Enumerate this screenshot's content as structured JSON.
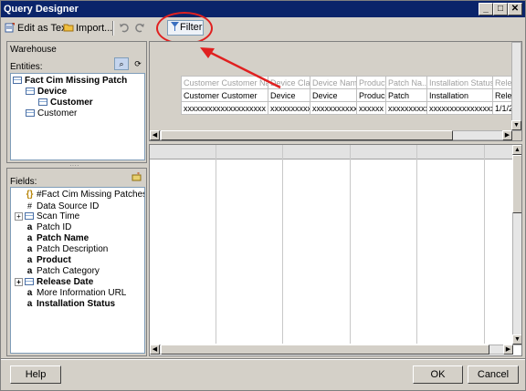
{
  "window": {
    "title": "Query Designer"
  },
  "title_buttons": {
    "minimize": "_",
    "maximize": "□",
    "close": "✕"
  },
  "toolbar": {
    "edit_as_text": "Edit as Text",
    "import": "Import...",
    "filter": "Filter"
  },
  "left_top": {
    "datasource": "Warehouse",
    "entities_label": "Entities:",
    "tree": [
      {
        "label": "Fact Cim Missing Patch",
        "bold": true,
        "level": 0
      },
      {
        "label": "Device",
        "bold": true,
        "level": 1
      },
      {
        "label": "Customer",
        "bold": true,
        "level": 2
      },
      {
        "label": "Customer",
        "bold": false,
        "level": 1
      }
    ]
  },
  "left_bottom": {
    "fields_label": "Fields:",
    "fields": [
      {
        "label": "#Fact Cim Missing Patches",
        "type": "calc",
        "bold": false
      },
      {
        "label": "Data Source ID",
        "type": "hash",
        "bold": false
      },
      {
        "label": "Scan Time",
        "type": "date",
        "bold": false,
        "expandable": true
      },
      {
        "label": "Patch ID",
        "type": "attr",
        "bold": false
      },
      {
        "label": "Patch Name",
        "type": "attr",
        "bold": true
      },
      {
        "label": "Patch Description",
        "type": "attr",
        "bold": false
      },
      {
        "label": "Product",
        "type": "attr",
        "bold": true
      },
      {
        "label": "Patch Category",
        "type": "attr",
        "bold": false
      },
      {
        "label": "Release Date",
        "type": "date",
        "bold": true,
        "expandable": true
      },
      {
        "label": "More Information URL",
        "type": "attr",
        "bold": false
      },
      {
        "label": "Installation Status",
        "type": "attr",
        "bold": true
      }
    ]
  },
  "query_grid": {
    "header": [
      "Customer Customer Na...",
      "Device Class",
      "Device Name",
      "Product",
      "Patch Na...",
      "Installation Status",
      "Relea"
    ],
    "row2": [
      "Customer Customer",
      "Device",
      "Device",
      "Produc",
      "Patch",
      "Installation",
      "Relea"
    ],
    "row3": [
      "xxxxxxxxxxxxxxxxxxxx",
      "xxxxxxxxxx",
      "xxxxxxxxxxx",
      "xxxxxx",
      "xxxxxxxxxx",
      "xxxxxxxxxxxxxxxxx",
      "1/1/2"
    ]
  },
  "footer": {
    "help": "Help",
    "ok": "OK",
    "cancel": "Cancel"
  },
  "colors": {
    "title_bg": "#0a246a",
    "highlight": "#e02020",
    "dialog_bg": "#d4d0c8"
  }
}
